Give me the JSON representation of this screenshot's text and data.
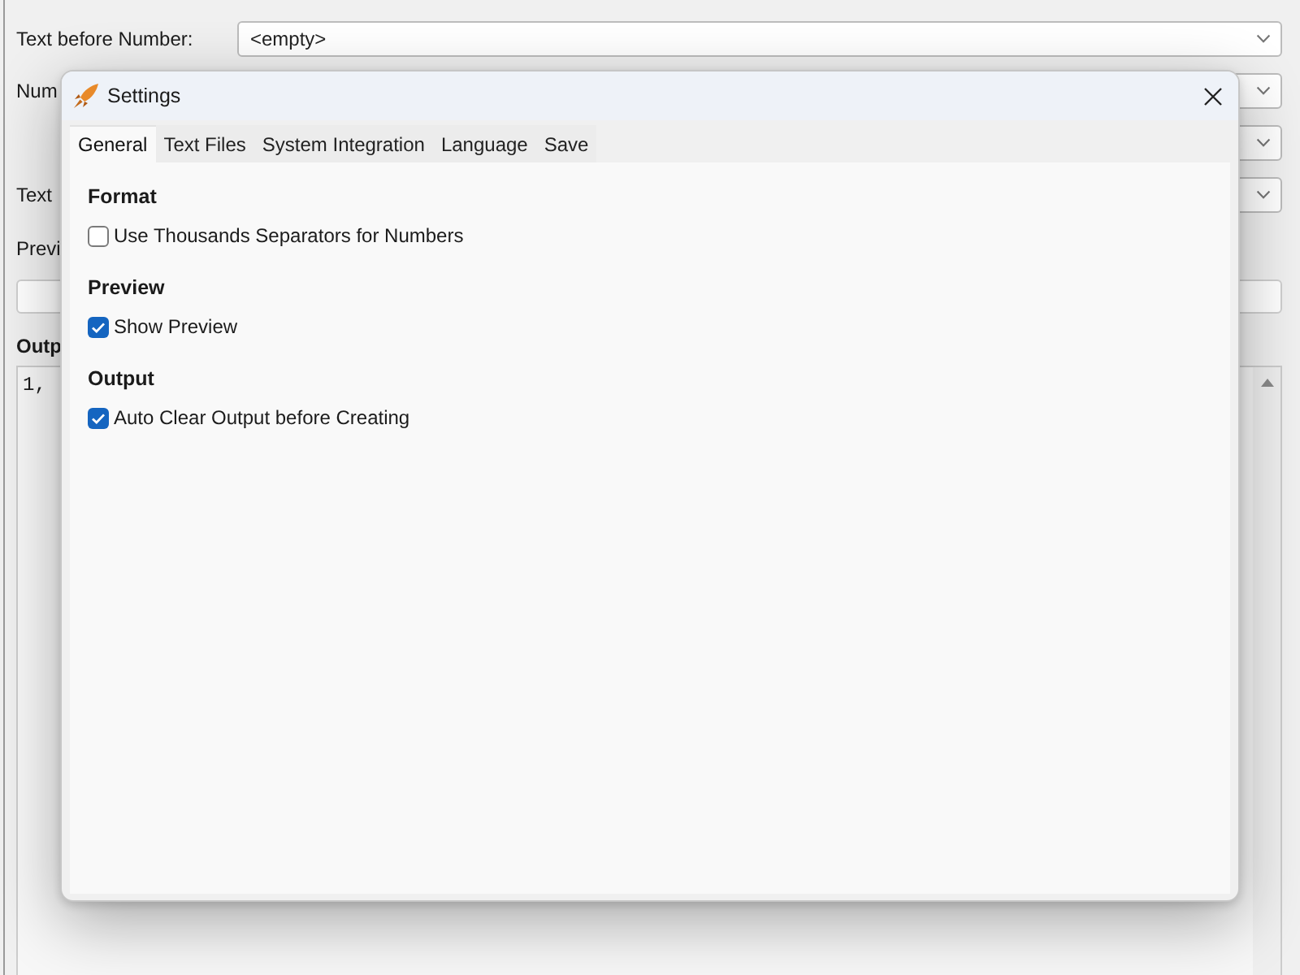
{
  "background_window": {
    "rows": [
      {
        "kind": "combo",
        "label": "Text before Number:",
        "value": "<empty>"
      },
      {
        "kind": "combo",
        "label": "Num"
      },
      {
        "kind": "combo"
      },
      {
        "kind": "combo",
        "label": "Text"
      }
    ],
    "preview": {
      "label": "Previ"
    },
    "output": {
      "label": "Outp",
      "text": "1,"
    }
  },
  "dialog": {
    "title": "Settings",
    "tabs": [
      {
        "label": "General",
        "selected": true
      },
      {
        "label": "Text Files",
        "selected": false
      },
      {
        "label": "System Integration",
        "selected": false
      },
      {
        "label": "Language",
        "selected": false
      },
      {
        "label": "Save",
        "selected": false
      }
    ],
    "sections": [
      {
        "heading": "Format",
        "options": [
          {
            "label": "Use Thousands Separators for Numbers",
            "checked": false
          }
        ]
      },
      {
        "heading": "Preview",
        "options": [
          {
            "label": "Show Preview",
            "checked": true
          }
        ]
      },
      {
        "heading": "Output",
        "options": [
          {
            "label": "Auto Clear Output before Creating",
            "checked": true
          }
        ]
      }
    ]
  }
}
